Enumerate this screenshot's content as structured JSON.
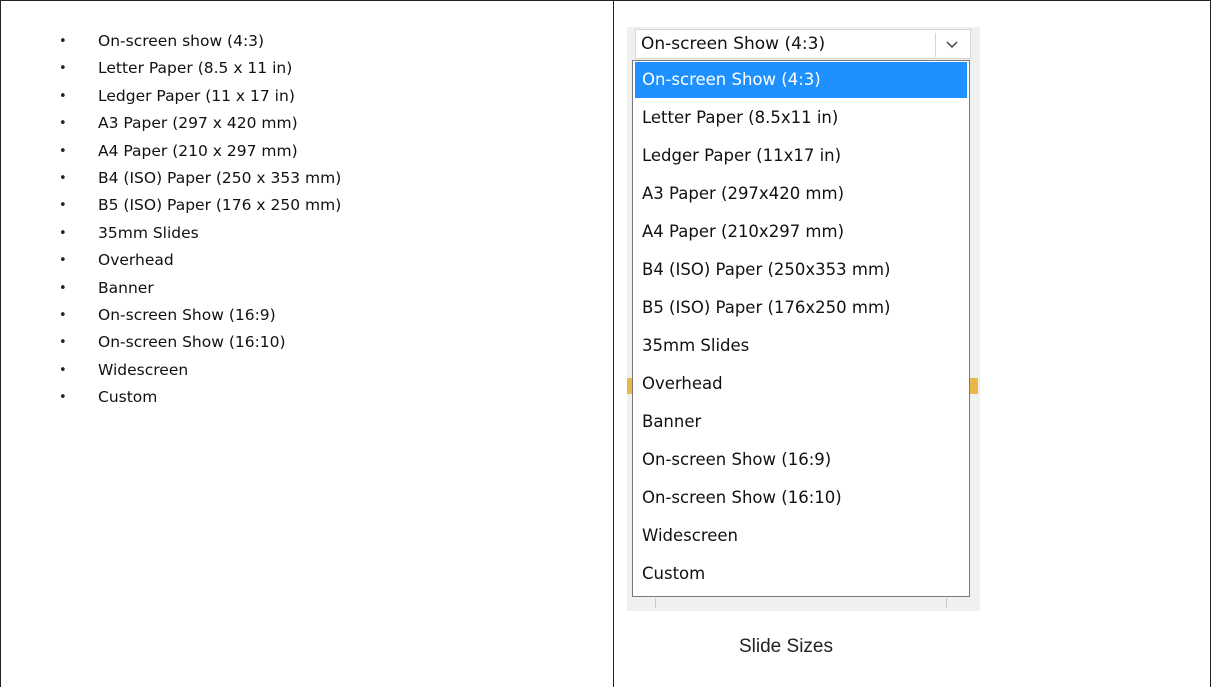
{
  "left_list": {
    "items": [
      "On-screen show (4:3)",
      "Letter Paper (8.5 x 11 in)",
      "Ledger Paper (11 x 17 in)",
      "A3 Paper (297 x 420 mm)",
      "A4 Paper (210 x 297 mm)",
      "B4 (ISO) Paper (250 x 353 mm)",
      "B5 (ISO) Paper (176 x 250 mm)",
      "35mm Slides",
      "Overhead",
      "Banner",
      "On-screen Show (16:9)",
      "On-screen Show (16:10)",
      "Widescreen",
      "Custom"
    ]
  },
  "dropdown": {
    "current_value": "On-screen Show (4:3)",
    "button_icon": "chevron-down-icon",
    "selected_color": "#1e90ff",
    "options": [
      "On-screen Show (4:3)",
      "Letter Paper (8.5x11 in)",
      "Ledger Paper (11x17 in)",
      "A3 Paper (297x420 mm)",
      "A4 Paper (210x297 mm)",
      "B4 (ISO) Paper (250x353 mm)",
      "B5 (ISO) Paper (176x250 mm)",
      "35mm Slides",
      "Overhead",
      "Banner",
      "On-screen Show (16:9)",
      "On-screen Show (16:10)",
      "Widescreen",
      "Custom"
    ]
  },
  "caption": "Slide Sizes"
}
